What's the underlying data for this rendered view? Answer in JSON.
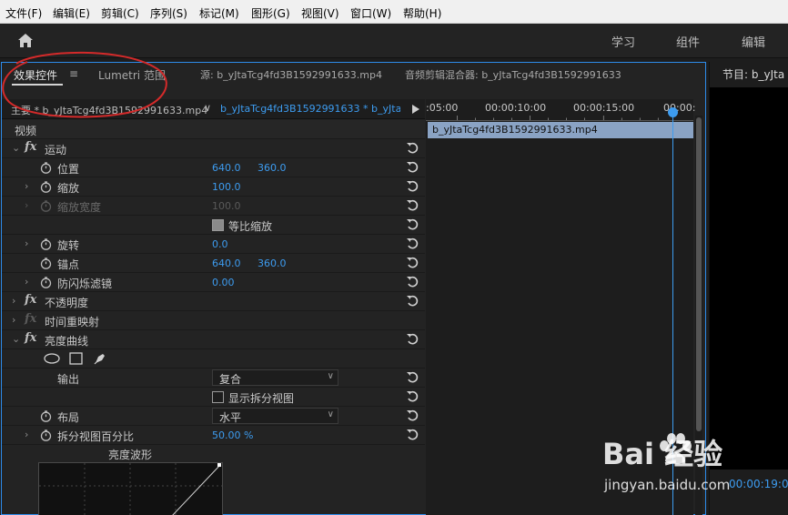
{
  "menu": {
    "items": [
      "文件(F)",
      "编辑(E)",
      "剪辑(C)",
      "序列(S)",
      "标记(M)",
      "图形(G)",
      "视图(V)",
      "窗口(W)",
      "帮助(H)"
    ]
  },
  "header": {
    "workspaces": [
      "学习",
      "组件",
      "编辑"
    ]
  },
  "panel_tabs": {
    "effect_controls": "效果控件",
    "menu_glyph": "≡",
    "lumetri": "Lumetri 范围",
    "source": "源: b_yJtaTcg4fd3B1592991633.mp4",
    "audio_mixer": "音频剪辑混合器: b_yJtaTcg4fd3B1592991633"
  },
  "clip_row": {
    "master": "主要 * b_yJtaTcg4fd3B1592991633.mp4",
    "sequence": "b_yJtaTcg4fd3B1592991633 * b_yJtaT...",
    "chevron": "∨"
  },
  "properties": {
    "video_header": "视频",
    "motion": "运动",
    "position": {
      "label": "位置",
      "x": "640.0",
      "y": "360.0"
    },
    "scale": {
      "label": "缩放",
      "value": "100.0"
    },
    "scale_width": {
      "label": "缩放宽度",
      "value": "100.0"
    },
    "uniform_scale": {
      "label": "等比缩放",
      "checked": true
    },
    "rotation": {
      "label": "旋转",
      "value": "0.0"
    },
    "anchor": {
      "label": "锚点",
      "x": "640.0",
      "y": "360.0"
    },
    "anti_flicker": {
      "label": "防闪烁滤镜",
      "value": "0.00"
    },
    "opacity": "不透明度",
    "time_remap": "时间重映射",
    "luma_curve": "亮度曲线",
    "output": {
      "label": "输出",
      "value": "复合"
    },
    "split_view": {
      "label": "显示拆分视图",
      "checked": false
    },
    "layout": {
      "label": "布局",
      "value": "水平"
    },
    "split_percent": {
      "label": "拆分视图百分比",
      "value": "50.00 %"
    },
    "curve_title": "亮度波形"
  },
  "timeline": {
    "tc_1": ":05:00",
    "tc_2": "00:00:10:00",
    "tc_3": "00:00:15:00",
    "tc_4": "00:00:",
    "clip_label": "b_yJtaTcg4fd3B1592991633.mp4"
  },
  "program": {
    "title": "节目: b_yJta",
    "timecode": "00:00:19:0"
  },
  "watermark": {
    "brand": "Bai 经验",
    "url": "jingyan.baidu.com"
  },
  "colors": {
    "accent_blue": "#3d9cf0",
    "panel_bg": "#232323",
    "annotation_red": "#d42a2a",
    "clip_bar": "#8aa3c4"
  }
}
